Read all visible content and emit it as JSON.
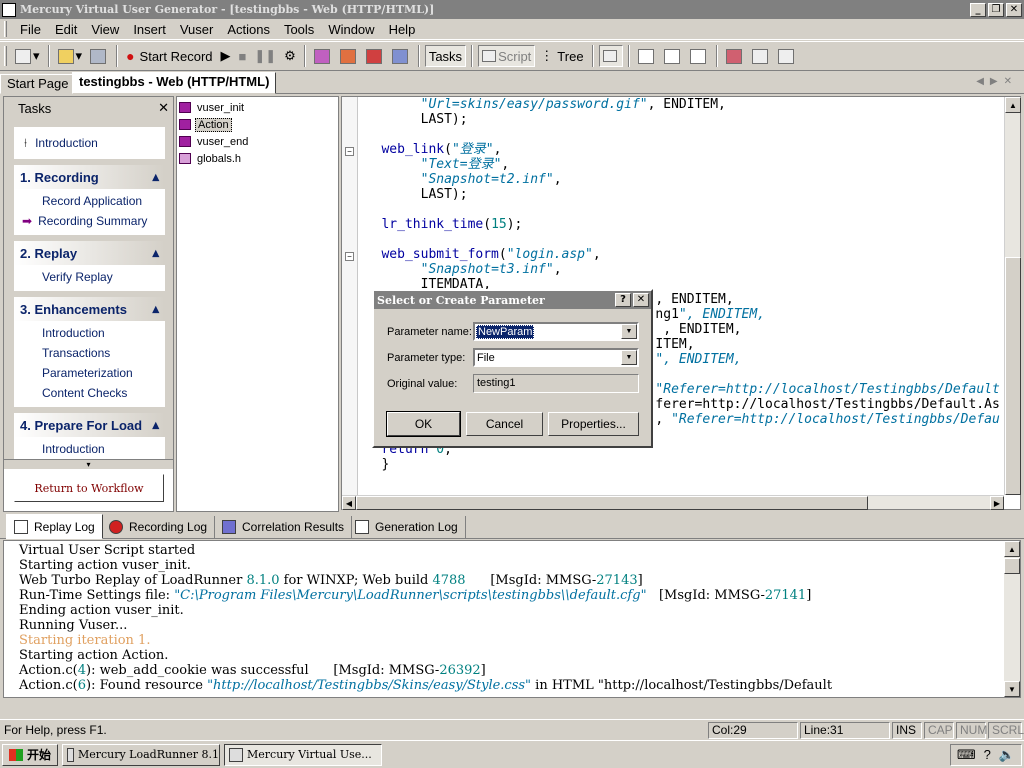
{
  "window": {
    "title": "Mercury Virtual User Generator - [testingbbs - Web (HTTP/HTML)]"
  },
  "menu": [
    "File",
    "Edit",
    "View",
    "Insert",
    "Vuser",
    "Actions",
    "Tools",
    "Window",
    "Help"
  ],
  "toolbar": {
    "start_record": "Start Record",
    "tasks": "Tasks",
    "script": "Script",
    "tree": "Tree"
  },
  "doc_tabs": {
    "start_page": "Start Page",
    "active": "testingbbs - Web (HTTP/HTML)"
  },
  "tasks": {
    "title": "Tasks",
    "intro": "Introduction",
    "groups": [
      {
        "title": "1. Recording",
        "items": [
          "Record Application",
          "Recording Summary"
        ]
      },
      {
        "title": "2. Replay",
        "items": [
          "Verify Replay"
        ]
      },
      {
        "title": "3. Enhancements",
        "items": [
          "Introduction",
          "Transactions",
          "Parameterization",
          "Content Checks"
        ]
      },
      {
        "title": "4. Prepare For Load",
        "items": [
          "Introduction"
        ]
      }
    ],
    "return_button": "Return to Workflow"
  },
  "tree": [
    "vuser_init",
    "Action",
    "vuser_end",
    "globals.h"
  ],
  "editor": {
    "lines": [
      "     \"Url=skins/easy/password.gif\", ENDITEM,",
      "     LAST);",
      "",
      "web_link(\"登录\",",
      "     \"Text=登录\",",
      "     \"Snapshot=t2.inf\",",
      "     LAST);",
      "",
      "lr_think_time(15);",
      "",
      "web_submit_form(\"login.asp\",",
      "     \"Snapshot=t3.inf\",",
      "     ITEMDATA,",
      "                                   , ENDITEM,",
      "                                   ng1\", ENDITEM,",
      "                                    , ENDITEM,",
      "                                   ITEM,",
      "                                   \", ENDITEM,",
      "",
      "                                   \"Referer=http://localhost/Testingbbs/Default",
      "                                   ferer=http://localhost/Testingbbs/Default.As",
      "                                   , \"Referer=http://localhost/Testingbbs/Defau",
      "",
      "return 0;",
      "}"
    ]
  },
  "dialog": {
    "title": "Select or Create Parameter",
    "name_label": "Parameter name:",
    "name_value": "NewParam",
    "type_label": "Parameter type:",
    "type_value": "File",
    "orig_label": "Original value:",
    "orig_value": "testing1",
    "ok": "OK",
    "cancel": "Cancel",
    "properties": "Properties..."
  },
  "log_tabs": [
    "Replay Log",
    "Recording Log",
    "Correlation Results",
    "Generation Log"
  ],
  "log": [
    "Virtual User Script started",
    "Starting action vuser_init.",
    "Web Turbo Replay of LoadRunner 8.1.0 for WINXP; Web build 4788      [MsgId: MMSG-27143]",
    "Run-Time Settings file: \"C:\\Program Files\\Mercury\\LoadRunner\\scripts\\testingbbs\\\\default.cfg\"   [MsgId: MMSG-27141]",
    "Ending action vuser_init.",
    "Running Vuser...",
    "Starting iteration 1.",
    "Starting action Action.",
    "Action.c(4): web_add_cookie was successful      [MsgId: MMSG-26392]",
    "Action.c(6): Found resource \"http://localhost/Testingbbs/Skins/easy/Style.css\" in HTML \"http://localhost/Testingbbs/Default"
  ],
  "status": {
    "help": "For Help, press F1.",
    "col": "Col:29",
    "line": "Line:31",
    "ins": "INS",
    "cap": "CAP",
    "num": "NUM",
    "scrl": "SCRL"
  },
  "taskbar": {
    "start": "开始",
    "tasks": [
      "Mercury LoadRunner 8.1",
      "Mercury Virtual Use..."
    ]
  }
}
